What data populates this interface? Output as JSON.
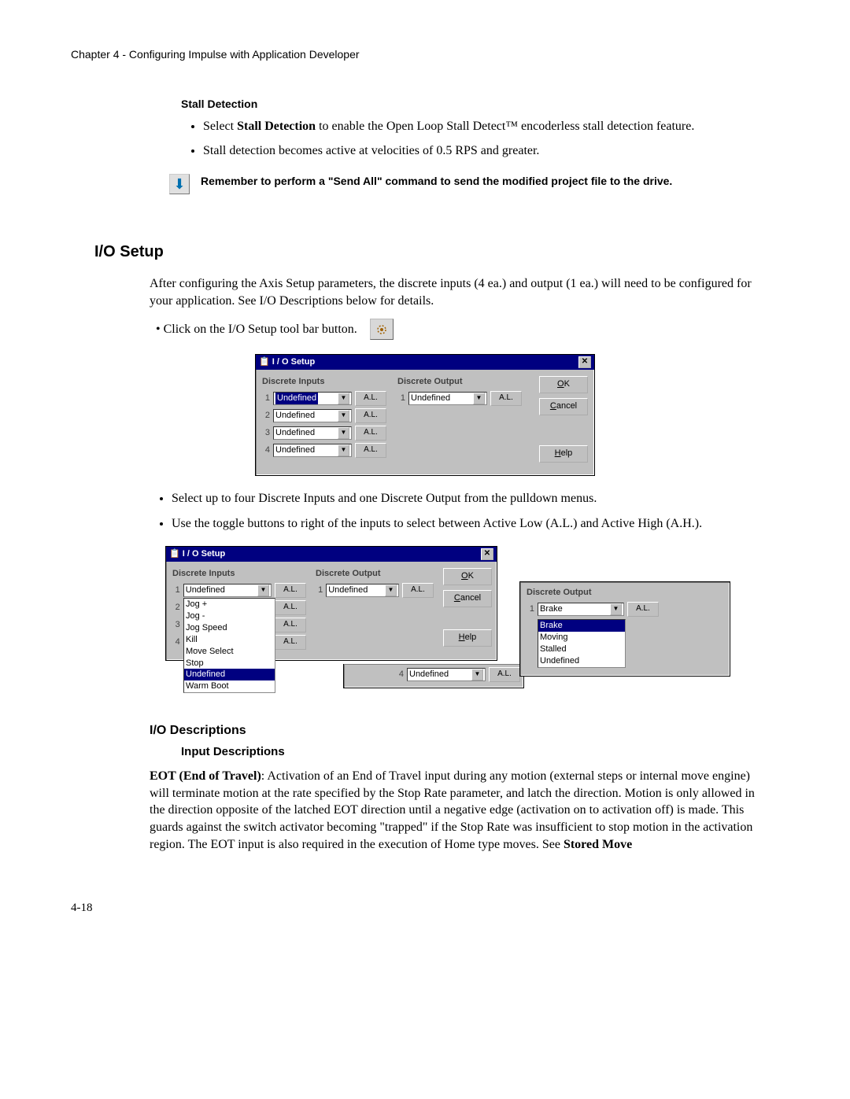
{
  "header": "Chapter 4 - Configuring Impulse with Application Developer",
  "stall": {
    "heading": "Stall Detection",
    "bullet1_pre": "Select ",
    "bullet1_bold": "Stall Detection",
    "bullet1_post": " to enable the Open Loop Stall Detect™ encoderless stall detection feature.",
    "bullet2": "Stall detection becomes active at velocities of 0.5 RPS and greater."
  },
  "note": "Remember to perform a \"Send All\" command to send the modified project file to the drive.",
  "io_setup": {
    "title": "I/O Setup",
    "para1": "After configuring the Axis Setup parameters, the discrete inputs (4 ea.) and output (1 ea.) will need to be configured for your application. See I/O Descriptions below for details.",
    "click_line_pre": "•   Click on the I/O Setup tool bar button.",
    "bullet_a": "Select up to four Discrete Inputs and one Discrete Output from the pulldown menus.",
    "bullet_b": "Use the toggle buttons to right of the inputs to select between Active Low (A.L.) and Active High (A.H.)."
  },
  "dlg": {
    "title": "I / O Setup",
    "inputs_label": "Discrete Inputs",
    "output_label": "Discrete Output",
    "undefined": "Undefined",
    "al": "A.L.",
    "ok": "OK",
    "cancel": "Cancel",
    "help": "Help",
    "list_items": [
      "Jog +",
      "Jog -",
      "Jog Speed",
      "Kill",
      "Move Select",
      "Stop",
      "Undefined",
      "Warm Boot"
    ],
    "out_items": [
      "Brake",
      "Moving",
      "Stalled",
      "Undefined"
    ],
    "out_sel": "Brake",
    "extra_row4_label": "4",
    "extra_row4_val": "Undefined"
  },
  "io_desc": {
    "h": "I/O Descriptions",
    "hh": "Input Descriptions",
    "eot_bold": "EOT (End of Travel)",
    "eot_body": ": Activation of an End of Travel input during any motion (external steps or internal move engine) will terminate motion at the rate specified by the Stop Rate parameter, and latch the direction. Motion is only allowed in the direction opposite of the latched EOT direction until a negative edge (activation on to activation off) is made.  This guards against the switch activator becoming \"trapped\" if the Stop Rate was insufficient to stop motion in the activation region.  The EOT input is also required in the execution of Home type moves.  See ",
    "eot_tail_bold": "Stored Move"
  },
  "page_num": "4-18"
}
